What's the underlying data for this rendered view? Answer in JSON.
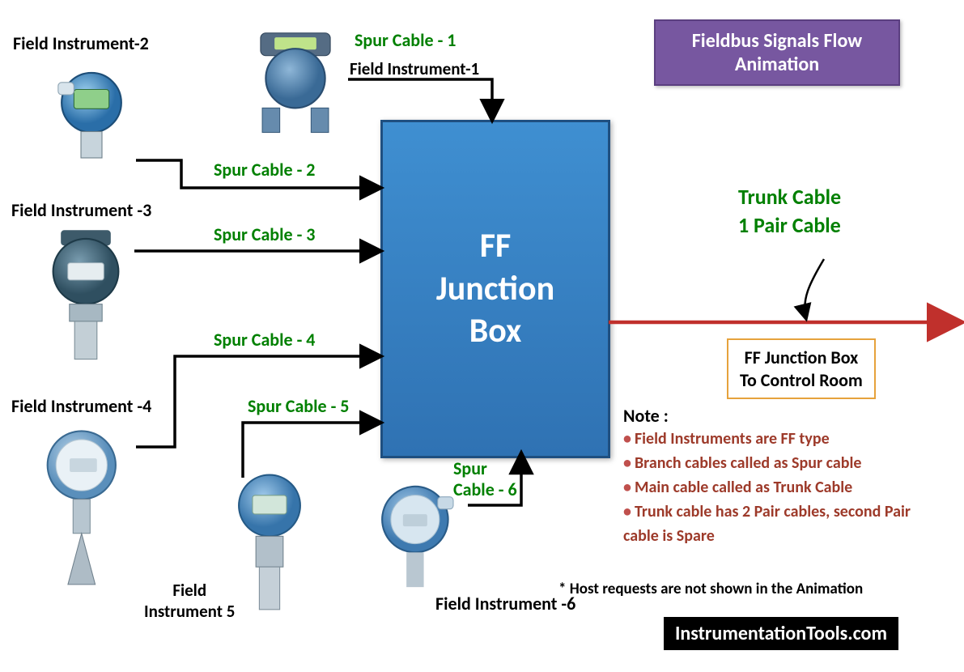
{
  "title": "Fieldbus Signals Flow Animation",
  "junction_box": "FF\nJunction\nBox",
  "instruments": {
    "i1": "Field Instrument-1",
    "i2": "Field Instrument-2",
    "i3": "Field Instrument -3",
    "i4": "Field Instrument -4",
    "i5": "Field\nInstrument 5",
    "i6": "Field Instrument -6"
  },
  "spurs": {
    "s1": "Spur Cable - 1",
    "s2": "Spur Cable - 2",
    "s3": "Spur Cable - 3",
    "s4": "Spur Cable - 4",
    "s5": "Spur Cable - 5",
    "s6": "Spur Cable - 6"
  },
  "trunk": {
    "title": "Trunk Cable\n1 Pair Cable",
    "to_control": "FF Junction Box\nTo Control Room"
  },
  "notes": {
    "heading": "Note :",
    "lines": [
      "Field Instruments are FF type",
      "Branch cables called as Spur cable",
      "Main cable called as Trunk Cable",
      "Trunk cable has 2 Pair cables, second Pair cable is Spare"
    ],
    "host": "* Host requests are not shown in the Animation"
  },
  "watermark": "InstrumentationTools.com"
}
